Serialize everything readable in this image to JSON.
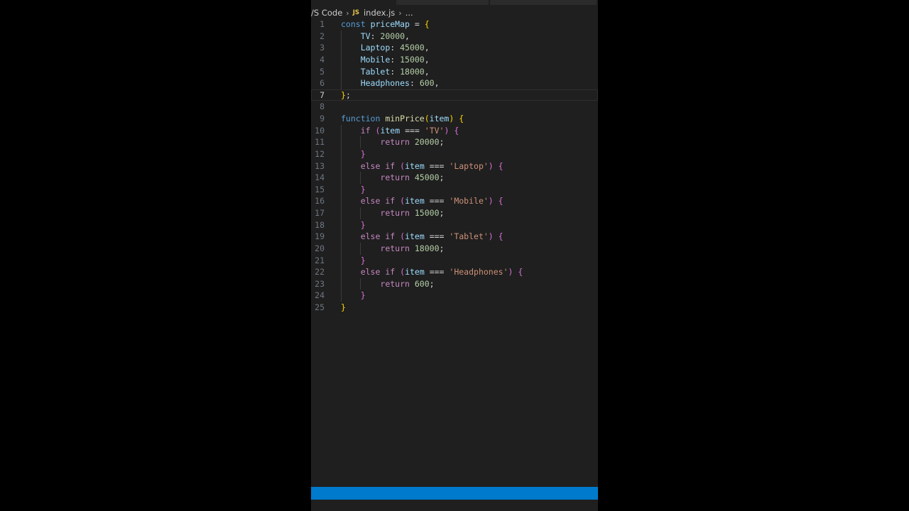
{
  "breadcrumb": {
    "root": "/S Code",
    "file_icon": "JS",
    "file": "index.js",
    "more": "..."
  },
  "editor": {
    "active_line": 7,
    "lines": [
      {
        "n": "1",
        "tokens": [
          {
            "t": "const",
            "c": "kw"
          },
          {
            "t": " "
          },
          {
            "t": "priceMap",
            "c": "var"
          },
          {
            "t": " = ",
            "c": "op"
          },
          {
            "t": "{",
            "c": "b1"
          }
        ]
      },
      {
        "n": "2",
        "tokens": [
          {
            "t": "    "
          },
          {
            "t": "TV",
            "c": "prop"
          },
          {
            "t": ": ",
            "c": "op"
          },
          {
            "t": "20000",
            "c": "num"
          },
          {
            "t": ",",
            "c": "op"
          }
        ]
      },
      {
        "n": "3",
        "tokens": [
          {
            "t": "    "
          },
          {
            "t": "Laptop",
            "c": "prop"
          },
          {
            "t": ": ",
            "c": "op"
          },
          {
            "t": "45000",
            "c": "num"
          },
          {
            "t": ",",
            "c": "op"
          }
        ]
      },
      {
        "n": "4",
        "tokens": [
          {
            "t": "    "
          },
          {
            "t": "Mobile",
            "c": "prop"
          },
          {
            "t": ": ",
            "c": "op"
          },
          {
            "t": "15000",
            "c": "num"
          },
          {
            "t": ",",
            "c": "op"
          }
        ]
      },
      {
        "n": "5",
        "tokens": [
          {
            "t": "    "
          },
          {
            "t": "Tablet",
            "c": "prop"
          },
          {
            "t": ": ",
            "c": "op"
          },
          {
            "t": "18000",
            "c": "num"
          },
          {
            "t": ",",
            "c": "op"
          }
        ]
      },
      {
        "n": "6",
        "tokens": [
          {
            "t": "    "
          },
          {
            "t": "Headphones",
            "c": "prop"
          },
          {
            "t": ": ",
            "c": "op"
          },
          {
            "t": "600",
            "c": "num"
          },
          {
            "t": ",",
            "c": "op"
          }
        ]
      },
      {
        "n": "7",
        "tokens": [
          {
            "t": "}",
            "c": "b1"
          },
          {
            "t": ";",
            "c": "op"
          }
        ]
      },
      {
        "n": "8",
        "tokens": []
      },
      {
        "n": "9",
        "tokens": [
          {
            "t": "function",
            "c": "kw"
          },
          {
            "t": " "
          },
          {
            "t": "minPrice",
            "c": "fn"
          },
          {
            "t": "(",
            "c": "b1"
          },
          {
            "t": "item",
            "c": "var"
          },
          {
            "t": ")",
            "c": "b1"
          },
          {
            "t": " "
          },
          {
            "t": "{",
            "c": "b1"
          }
        ]
      },
      {
        "n": "10",
        "tokens": [
          {
            "t": "    "
          },
          {
            "t": "if",
            "c": "ctrl"
          },
          {
            "t": " "
          },
          {
            "t": "(",
            "c": "b2"
          },
          {
            "t": "item",
            "c": "var"
          },
          {
            "t": " === ",
            "c": "op"
          },
          {
            "t": "'TV'",
            "c": "str"
          },
          {
            "t": ")",
            "c": "b2"
          },
          {
            "t": " "
          },
          {
            "t": "{",
            "c": "b2"
          }
        ]
      },
      {
        "n": "11",
        "tokens": [
          {
            "t": "        "
          },
          {
            "t": "return",
            "c": "ctrl"
          },
          {
            "t": " "
          },
          {
            "t": "20000",
            "c": "num"
          },
          {
            "t": ";",
            "c": "op"
          }
        ]
      },
      {
        "n": "12",
        "tokens": [
          {
            "t": "    "
          },
          {
            "t": "}",
            "c": "b2"
          }
        ]
      },
      {
        "n": "13",
        "tokens": [
          {
            "t": "    "
          },
          {
            "t": "else",
            "c": "ctrl"
          },
          {
            "t": " "
          },
          {
            "t": "if",
            "c": "ctrl"
          },
          {
            "t": " "
          },
          {
            "t": "(",
            "c": "b2"
          },
          {
            "t": "item",
            "c": "var"
          },
          {
            "t": " === ",
            "c": "op"
          },
          {
            "t": "'Laptop'",
            "c": "str"
          },
          {
            "t": ")",
            "c": "b2"
          },
          {
            "t": " "
          },
          {
            "t": "{",
            "c": "b2"
          }
        ]
      },
      {
        "n": "14",
        "tokens": [
          {
            "t": "        "
          },
          {
            "t": "return",
            "c": "ctrl"
          },
          {
            "t": " "
          },
          {
            "t": "45000",
            "c": "num"
          },
          {
            "t": ";",
            "c": "op"
          }
        ]
      },
      {
        "n": "15",
        "tokens": [
          {
            "t": "    "
          },
          {
            "t": "}",
            "c": "b2"
          }
        ]
      },
      {
        "n": "16",
        "tokens": [
          {
            "t": "    "
          },
          {
            "t": "else",
            "c": "ctrl"
          },
          {
            "t": " "
          },
          {
            "t": "if",
            "c": "ctrl"
          },
          {
            "t": " "
          },
          {
            "t": "(",
            "c": "b2"
          },
          {
            "t": "item",
            "c": "var"
          },
          {
            "t": " === ",
            "c": "op"
          },
          {
            "t": "'Mobile'",
            "c": "str"
          },
          {
            "t": ")",
            "c": "b2"
          },
          {
            "t": " "
          },
          {
            "t": "{",
            "c": "b2"
          }
        ]
      },
      {
        "n": "17",
        "tokens": [
          {
            "t": "        "
          },
          {
            "t": "return",
            "c": "ctrl"
          },
          {
            "t": " "
          },
          {
            "t": "15000",
            "c": "num"
          },
          {
            "t": ";",
            "c": "op"
          }
        ]
      },
      {
        "n": "18",
        "tokens": [
          {
            "t": "    "
          },
          {
            "t": "}",
            "c": "b2"
          }
        ]
      },
      {
        "n": "19",
        "tokens": [
          {
            "t": "    "
          },
          {
            "t": "else",
            "c": "ctrl"
          },
          {
            "t": " "
          },
          {
            "t": "if",
            "c": "ctrl"
          },
          {
            "t": " "
          },
          {
            "t": "(",
            "c": "b2"
          },
          {
            "t": "item",
            "c": "var"
          },
          {
            "t": " === ",
            "c": "op"
          },
          {
            "t": "'Tablet'",
            "c": "str"
          },
          {
            "t": ")",
            "c": "b2"
          },
          {
            "t": " "
          },
          {
            "t": "{",
            "c": "b2"
          }
        ]
      },
      {
        "n": "20",
        "tokens": [
          {
            "t": "        "
          },
          {
            "t": "return",
            "c": "ctrl"
          },
          {
            "t": " "
          },
          {
            "t": "18000",
            "c": "num"
          },
          {
            "t": ";",
            "c": "op"
          }
        ]
      },
      {
        "n": "21",
        "tokens": [
          {
            "t": "    "
          },
          {
            "t": "}",
            "c": "b2"
          }
        ]
      },
      {
        "n": "22",
        "tokens": [
          {
            "t": "    "
          },
          {
            "t": "else",
            "c": "ctrl"
          },
          {
            "t": " "
          },
          {
            "t": "if",
            "c": "ctrl"
          },
          {
            "t": " "
          },
          {
            "t": "(",
            "c": "b2"
          },
          {
            "t": "item",
            "c": "var"
          },
          {
            "t": " === ",
            "c": "op"
          },
          {
            "t": "'Headphones'",
            "c": "str"
          },
          {
            "t": ")",
            "c": "b2"
          },
          {
            "t": " "
          },
          {
            "t": "{",
            "c": "b2"
          }
        ]
      },
      {
        "n": "23",
        "tokens": [
          {
            "t": "        "
          },
          {
            "t": "return",
            "c": "ctrl"
          },
          {
            "t": " "
          },
          {
            "t": "600",
            "c": "num"
          },
          {
            "t": ";",
            "c": "op"
          }
        ]
      },
      {
        "n": "24",
        "tokens": [
          {
            "t": "    "
          },
          {
            "t": "}",
            "c": "b2"
          }
        ]
      },
      {
        "n": "25",
        "tokens": [
          {
            "t": "}",
            "c": "b1"
          }
        ]
      }
    ]
  },
  "colors": {
    "editor_background": "#1f1f1f",
    "status_bar": "#007acc",
    "outer_background": "#000000"
  }
}
